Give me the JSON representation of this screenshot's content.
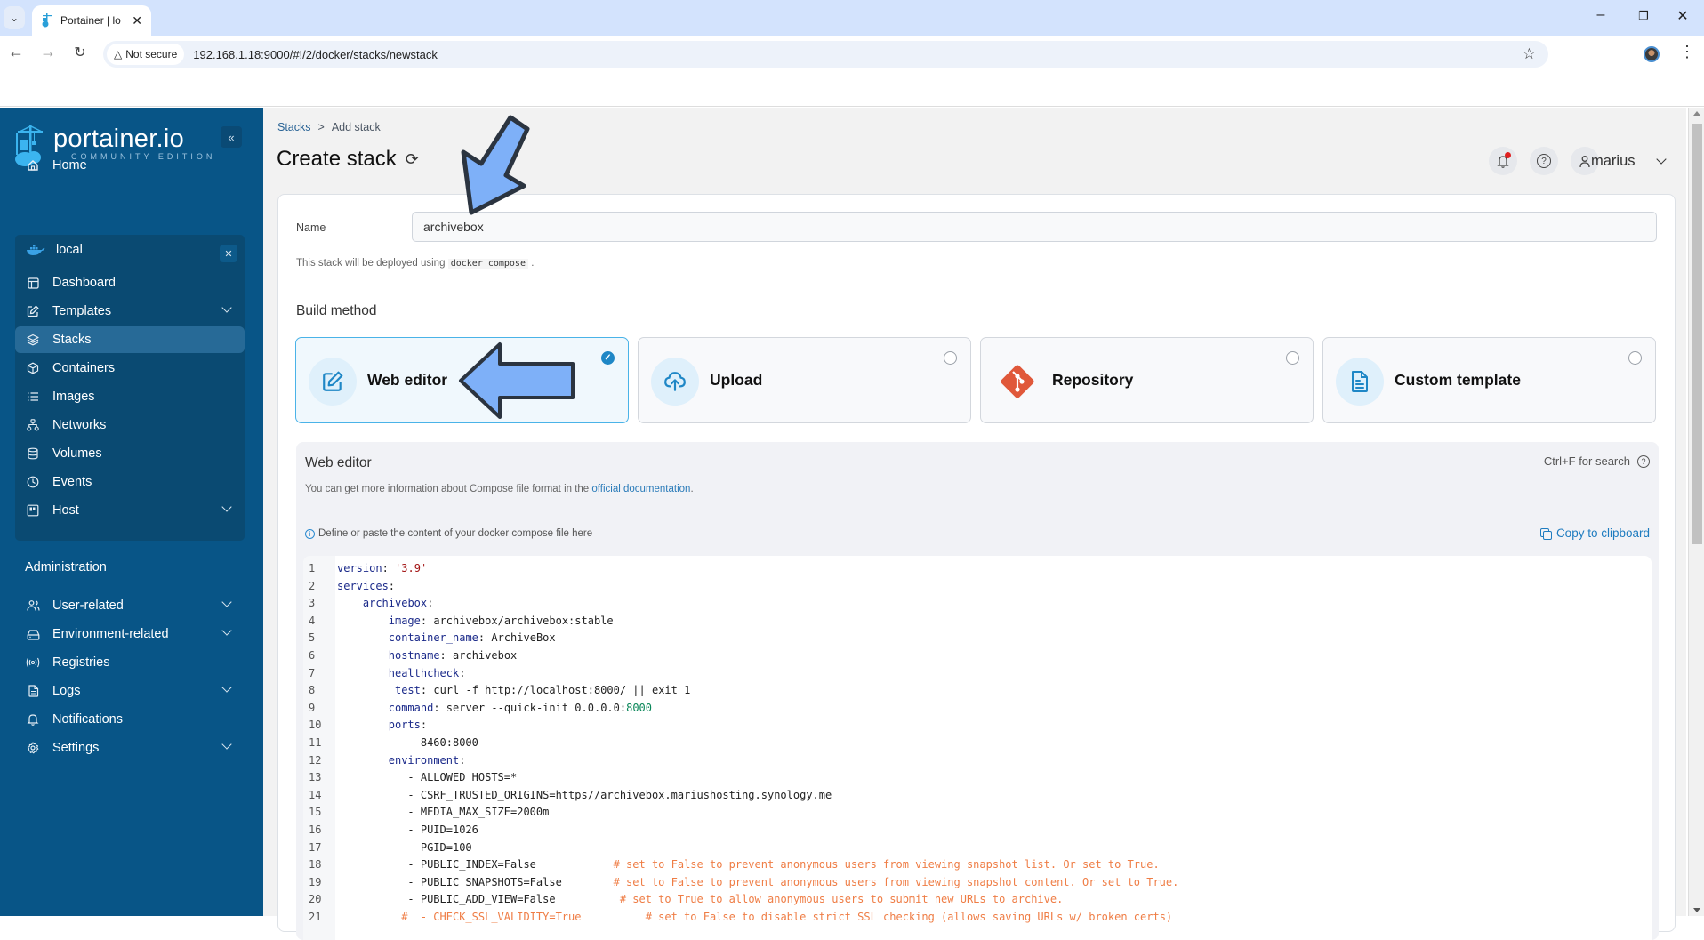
{
  "browser": {
    "tab_title": "Portainer | lo",
    "url": "192.168.1.18:9000/#!/2/docker/stacks/newstack",
    "security_label": "Not secure"
  },
  "sidebar": {
    "logo_text": "portainer.io",
    "logo_edition": "COMMUNITY EDITION",
    "home_label": "Home",
    "environment": {
      "name": "local",
      "items": [
        {
          "label": "Dashboard",
          "icon": "dashboard-icon",
          "expandable": false
        },
        {
          "label": "Templates",
          "icon": "edit-icon",
          "expandable": true
        },
        {
          "label": "Stacks",
          "icon": "layers-icon",
          "expandable": false,
          "active": true
        },
        {
          "label": "Containers",
          "icon": "box-icon",
          "expandable": false
        },
        {
          "label": "Images",
          "icon": "list-icon",
          "expandable": false
        },
        {
          "label": "Networks",
          "icon": "network-icon",
          "expandable": false
        },
        {
          "label": "Volumes",
          "icon": "database-icon",
          "expandable": false
        },
        {
          "label": "Events",
          "icon": "clock-icon",
          "expandable": false
        },
        {
          "label": "Host",
          "icon": "host-icon",
          "expandable": true
        }
      ]
    },
    "admin_title": "Administration",
    "admin_items": [
      {
        "label": "User-related",
        "icon": "users-icon",
        "expandable": true
      },
      {
        "label": "Environment-related",
        "icon": "drive-icon",
        "expandable": true
      },
      {
        "label": "Registries",
        "icon": "radio-icon",
        "expandable": false
      },
      {
        "label": "Logs",
        "icon": "file-icon",
        "expandable": true
      },
      {
        "label": "Notifications",
        "icon": "bell-icon",
        "expandable": false
      },
      {
        "label": "Settings",
        "icon": "gear-icon",
        "expandable": true
      }
    ]
  },
  "header": {
    "breadcrumb": [
      "Stacks",
      "Add stack"
    ],
    "breadcrumb_sep": ">",
    "title": "Create stack",
    "user": "marius"
  },
  "form": {
    "name_label": "Name",
    "name_value": "archivebox",
    "deploy_note_prefix": "This stack will be deployed using",
    "deploy_note_code": "docker compose",
    "deploy_note_suffix": ".",
    "build_method_title": "Build method",
    "build_methods": [
      {
        "label": "Web editor",
        "icon": "edit-icon",
        "selected": true
      },
      {
        "label": "Upload",
        "icon": "upload-cloud-icon",
        "selected": false
      },
      {
        "label": "Repository",
        "icon": "git-icon",
        "selected": false
      },
      {
        "label": "Custom template",
        "icon": "file-text-icon",
        "selected": false
      }
    ]
  },
  "editor": {
    "title": "Web editor",
    "search_hint": "Ctrl+F for search",
    "info_prefix": "You can get more information about Compose file format in the",
    "info_link": "official documentation",
    "info_suffix": ".",
    "define_note": "Define or paste the content of your docker compose file here",
    "copy_label": "Copy to clipboard",
    "lines": [
      {
        "n": "1",
        "indent": 0,
        "key": "version",
        "val": "'3.9'",
        "valtype": "s"
      },
      {
        "n": "2",
        "indent": 0,
        "key": "services",
        "val": "",
        "valtype": ""
      },
      {
        "n": "3",
        "indent": 4,
        "key": "archivebox",
        "val": "",
        "valtype": ""
      },
      {
        "n": "4",
        "indent": 8,
        "key": "image",
        "val": "archivebox/archivebox:stable",
        "valtype": "p"
      },
      {
        "n": "5",
        "indent": 8,
        "key": "container_name",
        "val": "ArchiveBox",
        "valtype": "p"
      },
      {
        "n": "6",
        "indent": 8,
        "key": "hostname",
        "val": "archivebox",
        "valtype": "p"
      },
      {
        "n": "7",
        "indent": 8,
        "key": "healthcheck",
        "val": "",
        "valtype": ""
      },
      {
        "n": "8",
        "indent": 9,
        "key": "test",
        "val": "curl -f http://localhost:8000/ || exit 1",
        "valtype": "p"
      },
      {
        "n": "9",
        "indent": 8,
        "key": "command",
        "val": "server --quick-init 0.0.0.0:",
        "val2": "8000",
        "valtype": "p"
      },
      {
        "n": "10",
        "indent": 8,
        "key": "ports",
        "val": "",
        "valtype": ""
      },
      {
        "n": "11",
        "indent": 11,
        "raw": "- 8460:8000"
      },
      {
        "n": "12",
        "indent": 8,
        "key": "environment",
        "val": "",
        "valtype": ""
      },
      {
        "n": "13",
        "indent": 11,
        "raw": "- ALLOWED_HOSTS=*"
      },
      {
        "n": "14",
        "indent": 11,
        "raw": "- CSRF_TRUSTED_ORIGINS=https//archivebox.mariushosting.synology.me"
      },
      {
        "n": "15",
        "indent": 11,
        "raw": "- MEDIA_MAX_SIZE=2000m"
      },
      {
        "n": "16",
        "indent": 11,
        "raw": "- PUID=1026"
      },
      {
        "n": "17",
        "indent": 11,
        "raw": "- PGID=100"
      },
      {
        "n": "18",
        "indent": 11,
        "raw": "- PUBLIC_INDEX=False            ",
        "comment": "# set to False to prevent anonymous users from viewing snapshot list. Or set to True."
      },
      {
        "n": "19",
        "indent": 11,
        "raw": "- PUBLIC_SNAPSHOTS=False        ",
        "comment": "# set to False to prevent anonymous users from viewing snapshot content. Or set to True."
      },
      {
        "n": "20",
        "indent": 11,
        "raw": "- PUBLIC_ADD_VIEW=False          ",
        "comment": "# set to True to allow anonymous users to submit new URLs to archive."
      },
      {
        "n": "21",
        "indent": 10,
        "raw": "",
        "comment": "#  - CHECK_SSL_VALIDITY=True          # set to False to disable strict SSL checking (allows saving URLs w/ broken certs)"
      }
    ]
  },
  "colors": {
    "sidebar_bg": "#085587",
    "accent": "#1f87c6",
    "annotation_arrow": "#7eb0f8",
    "git_orange": "#e0583a",
    "comment": "#ef7d45"
  }
}
